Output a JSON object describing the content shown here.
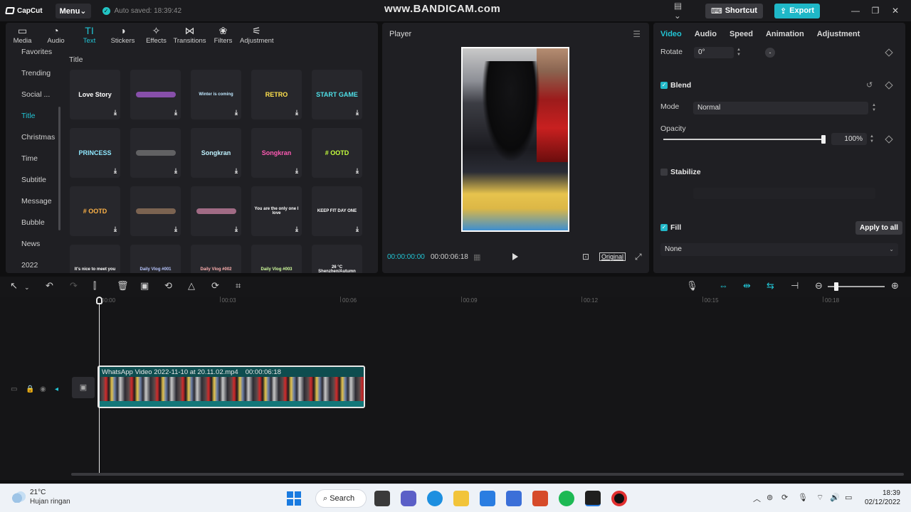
{
  "titlebar": {
    "app_name": "CapCut",
    "menu_label": "Menu",
    "autosave": "Auto saved: 18:39:42",
    "watermark": "www.BANDICAM.com",
    "shortcut_label": "Shortcut",
    "export_label": "Export"
  },
  "toolbar": {
    "tabs": [
      {
        "label": "Media",
        "icon": "media-icon"
      },
      {
        "label": "Audio",
        "icon": "audio-icon"
      },
      {
        "label": "Text",
        "icon": "text-icon"
      },
      {
        "label": "Stickers",
        "icon": "stickers-icon"
      },
      {
        "label": "Effects",
        "icon": "effects-icon"
      },
      {
        "label": "Transitions",
        "icon": "transitions-icon"
      },
      {
        "label": "Filters",
        "icon": "filters-icon"
      },
      {
        "label": "Adjustment",
        "icon": "adjustment-icon"
      }
    ],
    "active_tab": "Text"
  },
  "categories": [
    "Favorites",
    "Trending",
    "Social ...",
    "Title",
    "Christmas",
    "Time",
    "Subtitle",
    "Message",
    "Bubble",
    "News",
    "2022"
  ],
  "active_category": "Title",
  "section_title": "Title",
  "templates": [
    {
      "text": "Love Story",
      "color": "#ffffff"
    },
    {
      "text": "",
      "color": "#c86bff"
    },
    {
      "text": "Winter is coming",
      "color": "#bfe8ff"
    },
    {
      "text": "RETRO",
      "color": "#ffe14d"
    },
    {
      "text": "START GAME",
      "color": "#4fe0e8"
    },
    {
      "text": "PRINCESS",
      "color": "#8fe8ff"
    },
    {
      "text": "",
      "color": "#888888"
    },
    {
      "text": "Songkran",
      "color": "#bff2ff"
    },
    {
      "text": "Songkran",
      "color": "#ff5ab4"
    },
    {
      "text": "# OOTD",
      "color": "#c6ff3d"
    },
    {
      "text": "# OOTD",
      "color": "#ffb347"
    },
    {
      "text": "",
      "color": "#b48c6a"
    },
    {
      "text": "",
      "color": "#f49ac1"
    },
    {
      "text": "You are the only one I love",
      "color": "#ffffff"
    },
    {
      "text": "KEEP FIT DAY ONE",
      "color": "#ffffff"
    },
    {
      "text": "It's nice to meet you",
      "color": "#ffffff"
    },
    {
      "text": "Daily Vlog #001",
      "color": "#b8c6ff"
    },
    {
      "text": "Daily Vlog #002",
      "color": "#ffb0b0"
    },
    {
      "text": "Daily Vlog #003",
      "color": "#d2ff9e"
    },
    {
      "text": "26 °C Shenzhen/Autumn",
      "color": "#ffffff"
    }
  ],
  "player": {
    "title": "Player",
    "time_current": "00:00:00:00",
    "time_total": "00:00:06:18",
    "original_label": "Original"
  },
  "properties": {
    "tabs": [
      "Video",
      "Audio",
      "Speed",
      "Animation",
      "Adjustment"
    ],
    "active_tab": "Video",
    "rotate_label": "Rotate",
    "rotate_value": "0°",
    "blend_label": "Blend",
    "mode_label": "Mode",
    "mode_value": "Normal",
    "opacity_label": "Opacity",
    "opacity_value": "100%",
    "opacity_fraction": 1.0,
    "stabilize_label": "Stabilize",
    "fill_label": "Fill",
    "apply_all_label": "Apply to all",
    "fill_value": "None"
  },
  "timeline": {
    "ticks": [
      "00:00",
      "00:03",
      "00:06",
      "00:09",
      "00:12",
      "00:15",
      "00:18"
    ],
    "clip_name": "WhatsApp Video 2022-11-10 at 20.11.02.mp4",
    "clip_duration": "00:00:06:18"
  },
  "taskbar": {
    "temperature": "21°C",
    "weather": "Hujan ringan",
    "search_label": "Search",
    "time": "18:39",
    "date": "02/12/2022"
  },
  "colors": {
    "accent": "#22c4d4",
    "export": "#1fb8c8",
    "clip": "#0e4d4f"
  }
}
